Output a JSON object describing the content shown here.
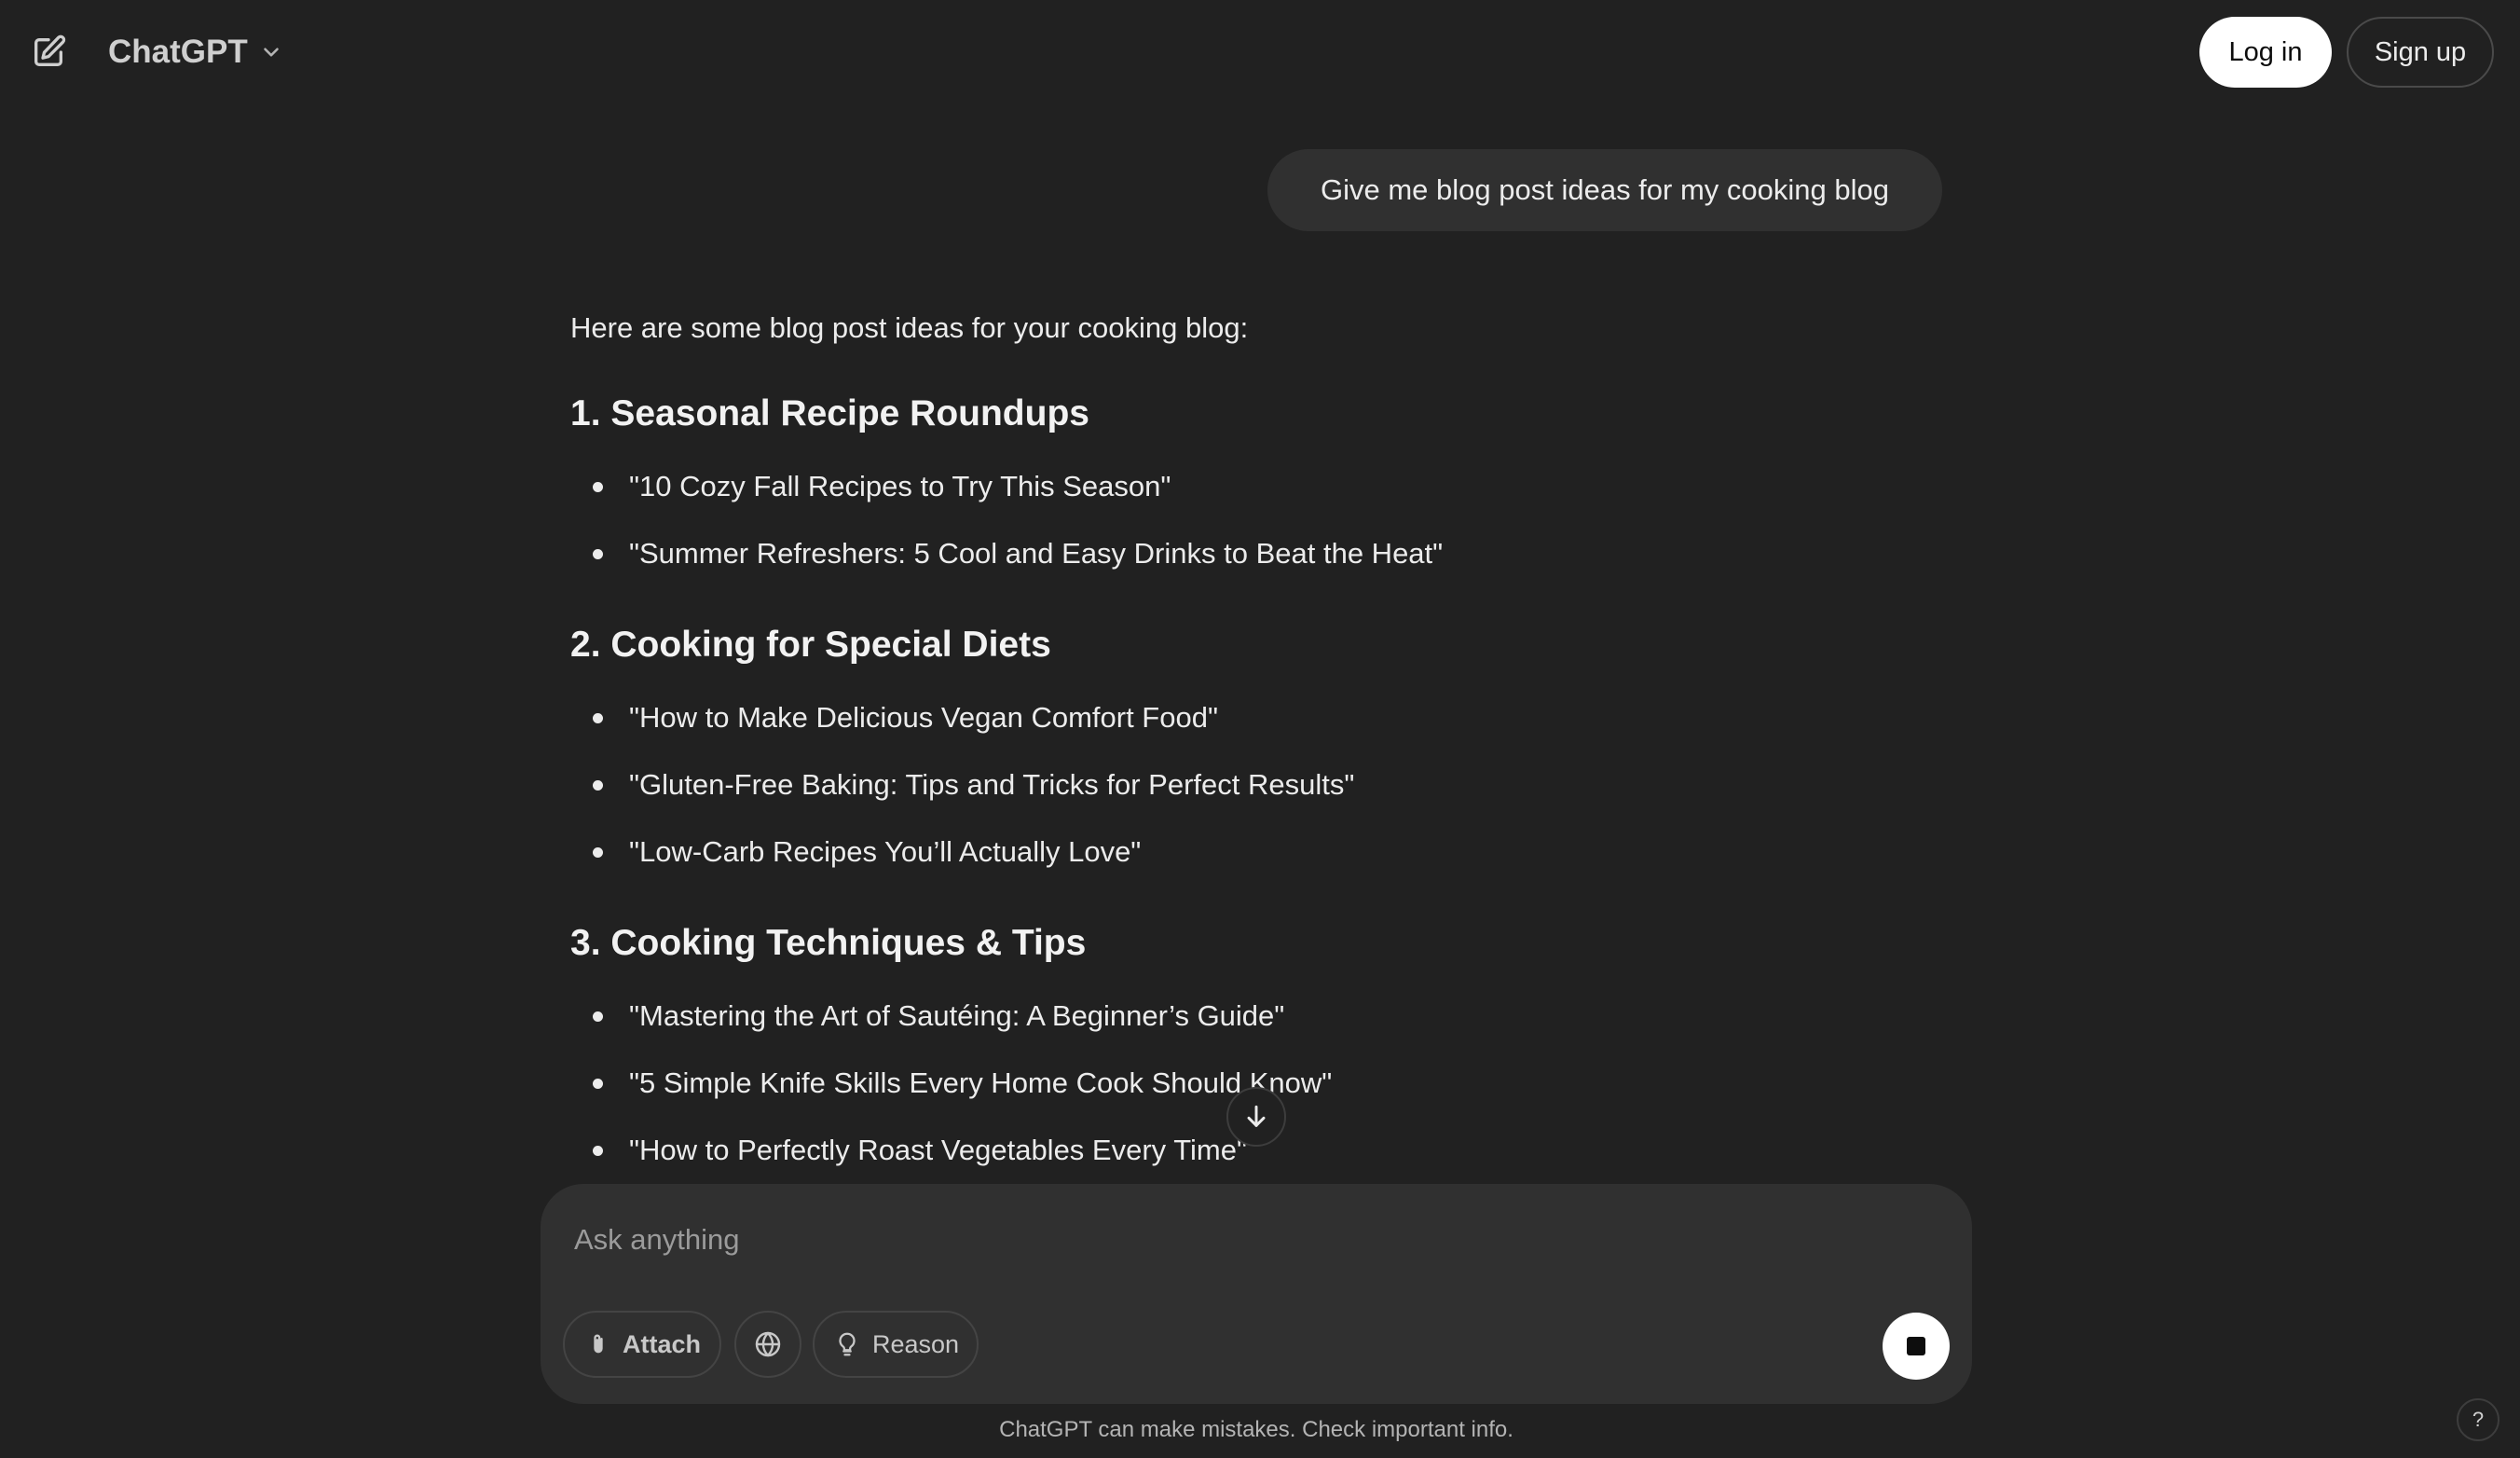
{
  "header": {
    "model_name": "ChatGPT",
    "login_label": "Log in",
    "signup_label": "Sign up",
    "new_chat_icon": "edit-icon",
    "model_chevron_icon": "chevron-down-icon"
  },
  "conversation": {
    "user_message": "Give me blog post ideas for my cooking blog",
    "assistant": {
      "intro": "Here are some blog post ideas for your cooking blog:",
      "sections": [
        {
          "heading": "1. Seasonal Recipe Roundups",
          "items": [
            "\"10 Cozy Fall Recipes to Try This Season\"",
            "\"Summer Refreshers: 5 Cool and Easy Drinks to Beat the Heat\""
          ]
        },
        {
          "heading": "2. Cooking for Special Diets",
          "items": [
            "\"How to Make Delicious Vegan Comfort Food\"",
            "\"Gluten-Free Baking: Tips and Tricks for Perfect Results\"",
            "\"Low-Carb Recipes You’ll Actually Love\""
          ]
        },
        {
          "heading": "3. Cooking Techniques & Tips",
          "items": [
            "\"Mastering the Art of Sautéing: A Beginner’s Guide\"",
            "\"5 Simple Knife Skills Every Home Cook Should Know\"",
            "\"How to Perfectly Roast Vegetables Every Time\""
          ]
        }
      ]
    }
  },
  "composer": {
    "placeholder": "Ask anything",
    "value": "",
    "attach_label": "Attach",
    "reason_label": "Reason",
    "icons": {
      "attach": "paperclip-icon",
      "search": "globe-icon",
      "reason": "lightbulb-icon",
      "stop": "stop-icon",
      "scroll": "arrow-down-icon"
    }
  },
  "footer": {
    "disclaimer": "ChatGPT can make mistakes. Check important info.",
    "help_label": "?"
  },
  "colors": {
    "background": "#212121",
    "bubble": "#303030",
    "text": "#ececec",
    "muted": "#b4b4b4",
    "button_light": "#ffffff"
  }
}
